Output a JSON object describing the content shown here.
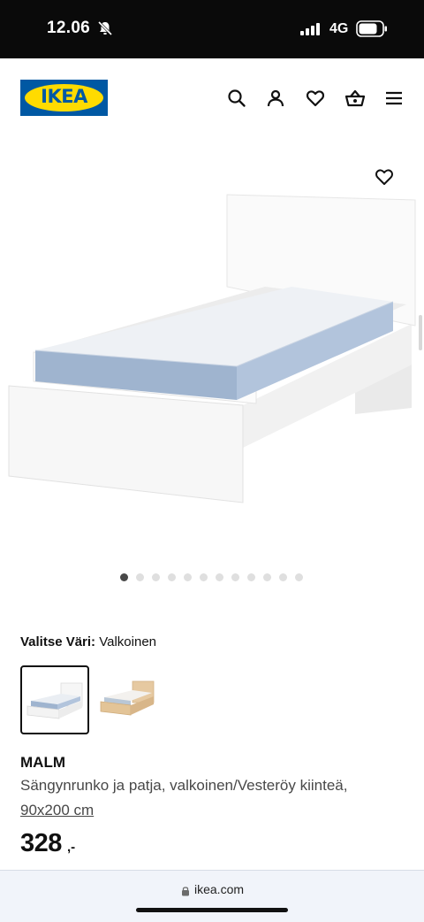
{
  "status_bar": {
    "time": "12.06",
    "network": "4G"
  },
  "header": {
    "logo_text": "IKEA",
    "icons": [
      "search-icon",
      "user-icon",
      "heart-icon",
      "basket-icon",
      "menu-icon"
    ]
  },
  "gallery": {
    "image_count": 12,
    "active_index": 0
  },
  "color": {
    "label": "Valitse Väri:",
    "value": "Valkoinen"
  },
  "product": {
    "name": "MALM",
    "description": "Sängynrunko ja patja, valkoinen/Vesteröy kiinteä,",
    "size": "90x200 cm",
    "price": "328",
    "price_suffix": ",-"
  },
  "browser": {
    "url": "ikea.com"
  },
  "colors": {
    "ikea_blue": "#0058a3",
    "ikea_yellow": "#ffdb00",
    "mattress_blue": "#9fb4cf"
  }
}
